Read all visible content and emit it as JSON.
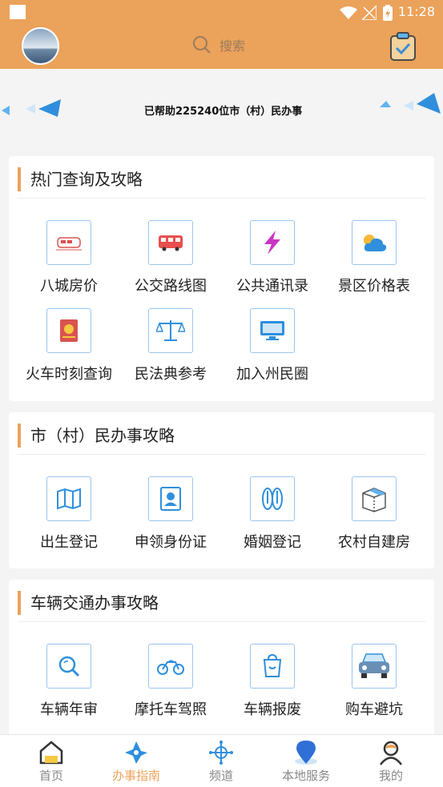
{
  "status_bar": {
    "time": "11:28"
  },
  "header": {
    "search_placeholder": "搜索"
  },
  "marquee": {
    "text": "已帮助225240位市（村）民办事"
  },
  "sections": [
    {
      "title": "热门查询及攻略",
      "items": [
        {
          "label": "八城房价",
          "icon": "train-icon"
        },
        {
          "label": "公交路线图",
          "icon": "bus-icon"
        },
        {
          "label": "公共通讯录",
          "icon": "lightning-icon"
        },
        {
          "label": "景区价格表",
          "icon": "weather-icon"
        },
        {
          "label": "火车时刻查询",
          "icon": "book-icon"
        },
        {
          "label": "民法典参考",
          "icon": "scales-icon"
        },
        {
          "label": "加入州民圈",
          "icon": "computer-icon"
        }
      ]
    },
    {
      "title": "市（村）民办事攻略",
      "items": [
        {
          "label": "出生登记",
          "icon": "map-icon"
        },
        {
          "label": "申领身份证",
          "icon": "id-card-icon"
        },
        {
          "label": "婚姻登记",
          "icon": "footprints-icon"
        },
        {
          "label": "农村自建房",
          "icon": "box-icon"
        }
      ]
    },
    {
      "title": "车辆交通办事攻略",
      "items": [
        {
          "label": "车辆年审",
          "icon": "magnifier-icon"
        },
        {
          "label": "摩托车驾照",
          "icon": "motorcycle-icon"
        },
        {
          "label": "车辆报废",
          "icon": "trash-icon"
        },
        {
          "label": "购车避坑",
          "icon": "car-icon"
        }
      ]
    }
  ],
  "nav": [
    {
      "label": "首页",
      "icon": "home-icon",
      "active": false
    },
    {
      "label": "办事指南",
      "icon": "guide-icon",
      "active": true
    },
    {
      "label": "频道",
      "icon": "channel-icon",
      "active": false
    },
    {
      "label": "本地服务",
      "icon": "location-icon",
      "active": false
    },
    {
      "label": "我的",
      "icon": "user-icon",
      "active": false
    }
  ],
  "colors": {
    "accent": "#eba25a",
    "icon_border": "#9ac6ef",
    "blue": "#2f8fdc"
  }
}
